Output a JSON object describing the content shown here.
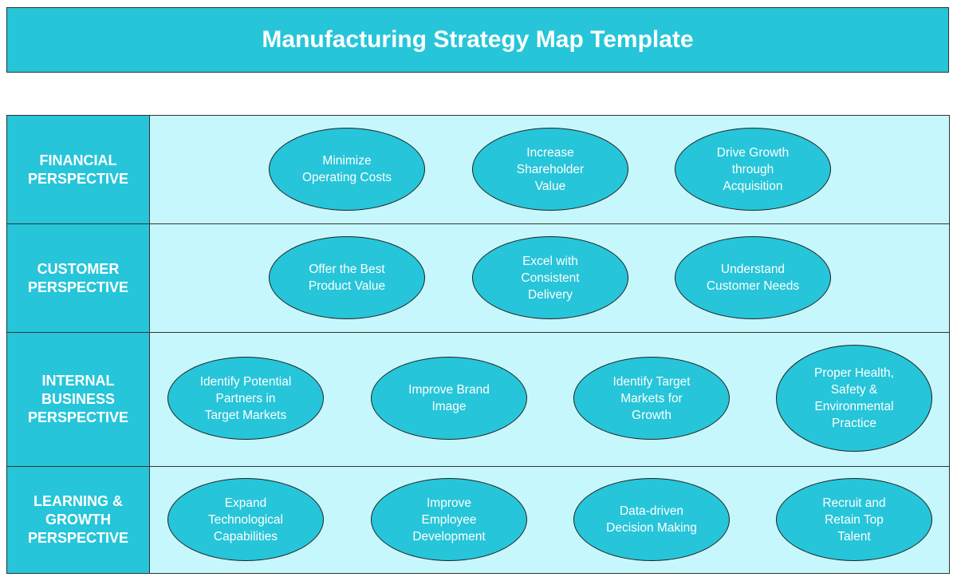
{
  "title": "Manufacturing Strategy Map Template",
  "colors": {
    "accent": "#26c5d9",
    "cell_background": "#c6f7fd",
    "border": "#333333",
    "text": "#ffffff"
  },
  "perspectives": [
    {
      "label": "FINANCIAL\nPERSPECTIVE",
      "objectives": [
        "Minimize\nOperating Costs",
        "Increase\nShareholder\nValue",
        "Drive Growth\nthrough\nAcquisition"
      ]
    },
    {
      "label": "CUSTOMER\nPERSPECTIVE",
      "objectives": [
        "Offer the Best\nProduct Value",
        "Excel with\nConsistent\nDelivery",
        "Understand\nCustomer Needs"
      ]
    },
    {
      "label": "INTERNAL\nBUSINESS\nPERSPECTIVE",
      "objectives": [
        "Identify Potential\nPartners in\nTarget Markets",
        "Improve Brand\nImage",
        "Identify Target\nMarkets for\nGrowth",
        "Proper Health,\nSafety &\nEnvironmental\nPractice"
      ]
    },
    {
      "label": "LEARNING &\nGROWTH\nPERSPECTIVE",
      "objectives": [
        "Expand\nTechnological\nCapabilities",
        "Improve\nEmployee\nDevelopment",
        "Data-driven\nDecision Making",
        "Recruit and\nRetain Top\nTalent"
      ]
    }
  ]
}
